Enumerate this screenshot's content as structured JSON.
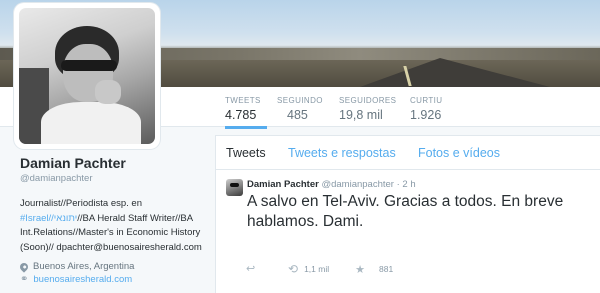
{
  "profile": {
    "name": "Damian Pachter",
    "handle": "@damianpachter",
    "bio": {
      "part1": "Journalist//Periodista esp. en ",
      "link": "#Israel//יתונאי",
      "part2": "//BA Herald Staff Writer//BA Int.Relations//Master's in Economic History (Soon)// dpachter@buenosairesherald.com"
    },
    "location": "Buenos Aires, Argentina",
    "website": "buenosairesherald.com"
  },
  "stats": [
    {
      "label": "TWEETS",
      "value": "4.785"
    },
    {
      "label": "SEGUINDO",
      "value": "485"
    },
    {
      "label": "SEGUIDORES",
      "value": "19,8 mil"
    },
    {
      "label": "CURTIU",
      "value": "1.926"
    }
  ],
  "tabs": {
    "tweets": "Tweets",
    "replies": "Tweets e respostas",
    "media": "Fotos e vídeos"
  },
  "tweet": {
    "name": "Damian Pachter",
    "handle": "@damianpachter",
    "time": "· 2 h",
    "text": "A salvo en Tel-Aviv. Gracias a todos. En breve hablamos. Dami.",
    "retweets": "1,1 mil",
    "likes": "881"
  },
  "icons": {
    "location": "map-pin-icon",
    "website": "link-icon",
    "reply": "reply-icon",
    "retweet": "retweet-icon",
    "like": "star-icon"
  },
  "colors": {
    "accent": "#55acee",
    "text": "#292f33",
    "muted": "#8899a6"
  }
}
